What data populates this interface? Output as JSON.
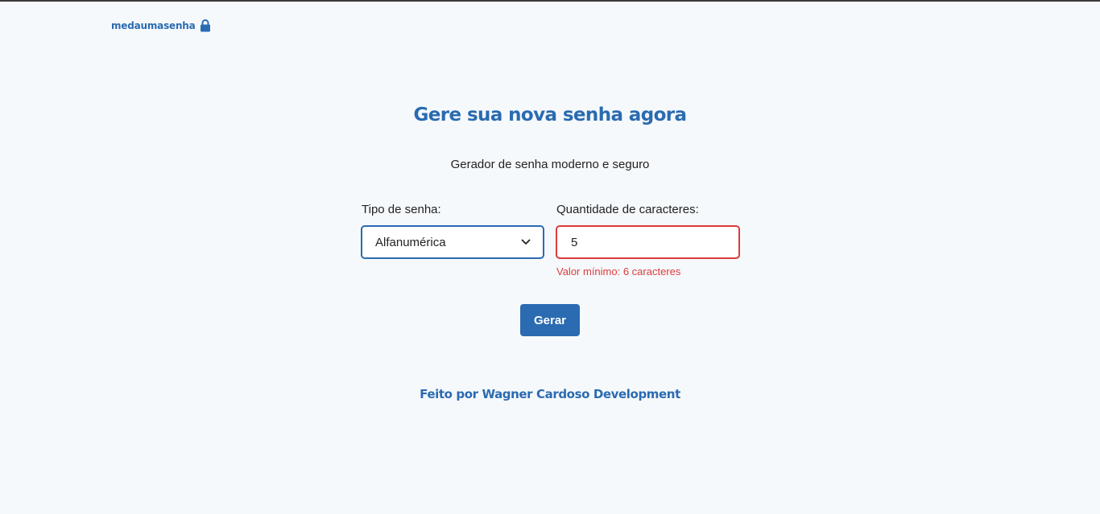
{
  "header": {
    "brand": "medaumasenha",
    "brand_icon": "lock-icon"
  },
  "main": {
    "title": "Gere sua nova senha agora",
    "subtitle": "Gerador de senha moderno e seguro",
    "type_field": {
      "label": "Tipo de senha:",
      "selected": "Alfanumérica"
    },
    "length_field": {
      "label": "Quantidade de caracteres:",
      "value": "5",
      "error": "Valor mínimo: 6 caracteres"
    },
    "generate_button": "Gerar"
  },
  "footer": {
    "credit": "Feito por Wagner Cardoso Development"
  },
  "colors": {
    "accent": "#2a6bb1",
    "error": "#dc3b3b",
    "background": "#f6f9fc"
  }
}
